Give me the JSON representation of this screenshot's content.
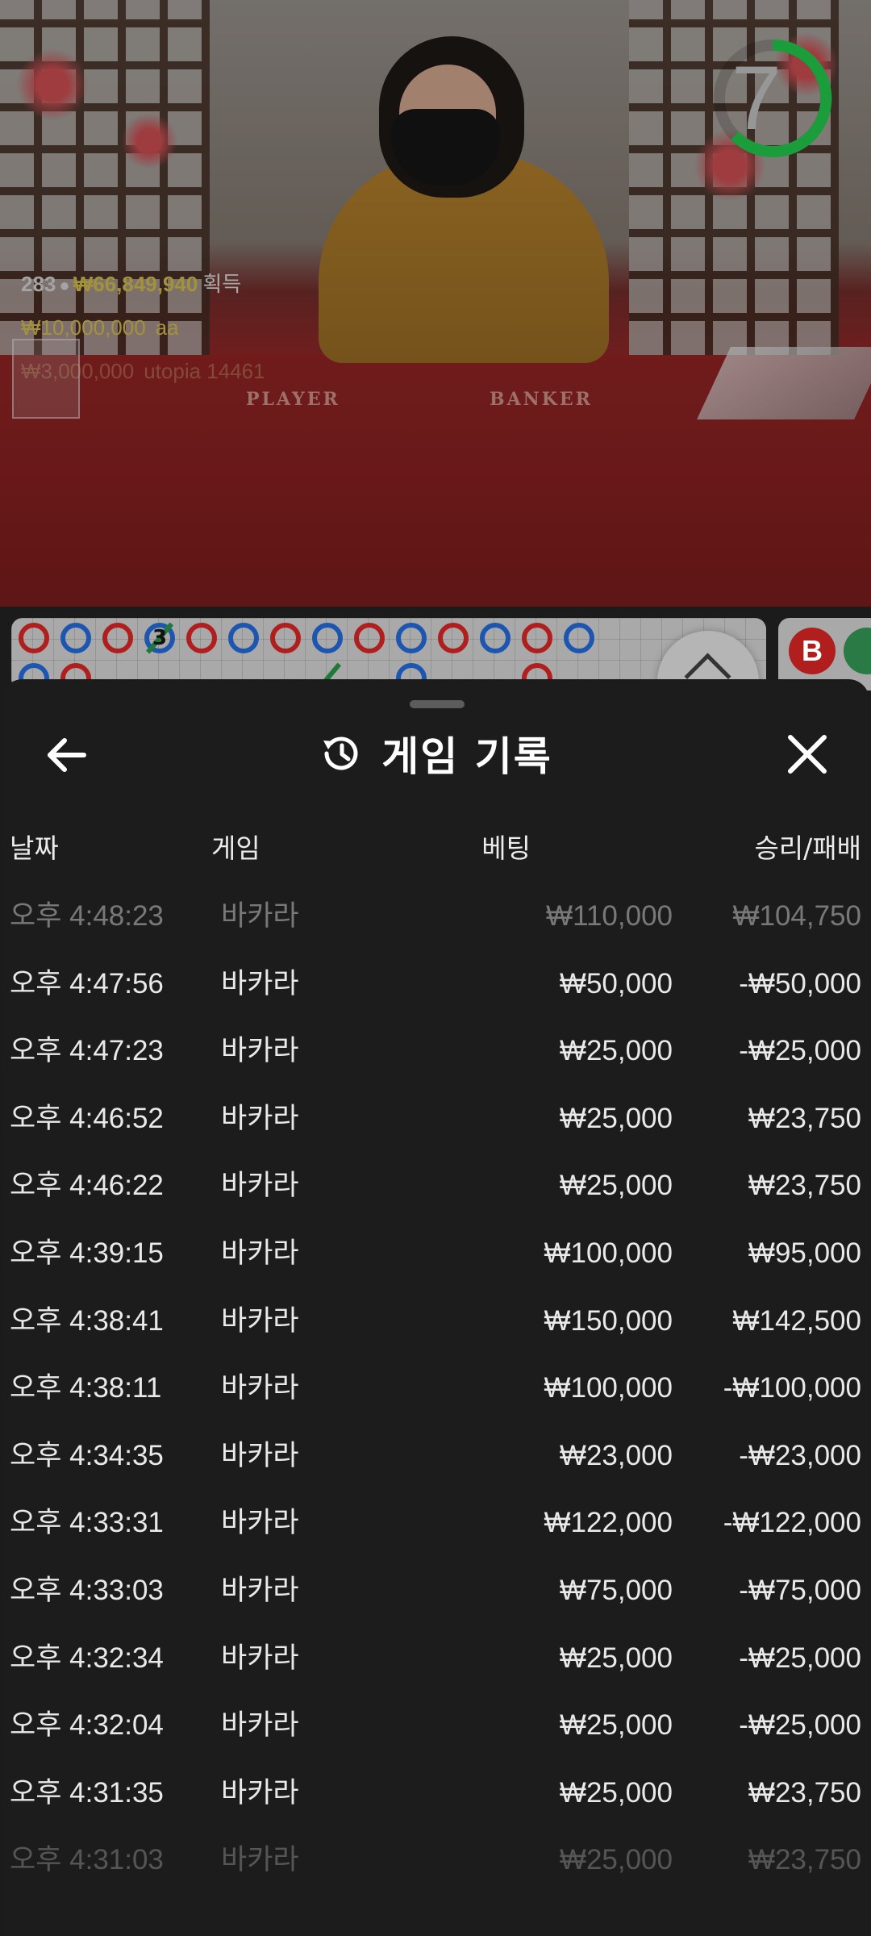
{
  "stream": {
    "timer": "7",
    "timer_color": "#22c04a",
    "table_labels": {
      "player": "PLAYER",
      "banker": "BANKER"
    },
    "winners": {
      "count": "283",
      "total": "₩66,849,940",
      "total_suffix": "획득",
      "entries": [
        {
          "amount": "₩10,000,000",
          "name": "aa"
        },
        {
          "amount": "₩3,000,000",
          "name": "utopia 14461"
        }
      ]
    }
  },
  "roadmap": {
    "top_row": [
      "red",
      "blue",
      "red",
      "blue",
      "red",
      "blue",
      "red",
      "blue",
      "red",
      "blue",
      "red",
      "blue",
      "red",
      "blue"
    ],
    "tie_count": "3",
    "badge": "B"
  },
  "sheet": {
    "title": "게임 기록",
    "icons": {
      "back": "arrow-left-icon",
      "history": "history-icon",
      "close": "close-icon"
    },
    "columns": {
      "date": "날짜",
      "game": "게임",
      "bet": "베팅",
      "result": "승리/패배"
    },
    "rows": [
      {
        "date": "오후 4:48:23",
        "game": "바카라",
        "bet": "₩110,000",
        "result": "₩104,750"
      },
      {
        "date": "오후 4:47:56",
        "game": "바카라",
        "bet": "₩50,000",
        "result": "-₩50,000"
      },
      {
        "date": "오후 4:47:23",
        "game": "바카라",
        "bet": "₩25,000",
        "result": "-₩25,000"
      },
      {
        "date": "오후 4:46:52",
        "game": "바카라",
        "bet": "₩25,000",
        "result": "₩23,750"
      },
      {
        "date": "오후 4:46:22",
        "game": "바카라",
        "bet": "₩25,000",
        "result": "₩23,750"
      },
      {
        "date": "오후 4:39:15",
        "game": "바카라",
        "bet": "₩100,000",
        "result": "₩95,000"
      },
      {
        "date": "오후 4:38:41",
        "game": "바카라",
        "bet": "₩150,000",
        "result": "₩142,500"
      },
      {
        "date": "오후 4:38:11",
        "game": "바카라",
        "bet": "₩100,000",
        "result": "-₩100,000"
      },
      {
        "date": "오후 4:34:35",
        "game": "바카라",
        "bet": "₩23,000",
        "result": "-₩23,000"
      },
      {
        "date": "오후 4:33:31",
        "game": "바카라",
        "bet": "₩122,000",
        "result": "-₩122,000"
      },
      {
        "date": "오후 4:33:03",
        "game": "바카라",
        "bet": "₩75,000",
        "result": "-₩75,000"
      },
      {
        "date": "오후 4:32:34",
        "game": "바카라",
        "bet": "₩25,000",
        "result": "-₩25,000"
      },
      {
        "date": "오후 4:32:04",
        "game": "바카라",
        "bet": "₩25,000",
        "result": "-₩25,000"
      },
      {
        "date": "오후 4:31:35",
        "game": "바카라",
        "bet": "₩25,000",
        "result": "₩23,750"
      },
      {
        "date": "오후 4:31:03",
        "game": "바카라",
        "bet": "₩25,000",
        "result": "₩23,750"
      }
    ]
  }
}
